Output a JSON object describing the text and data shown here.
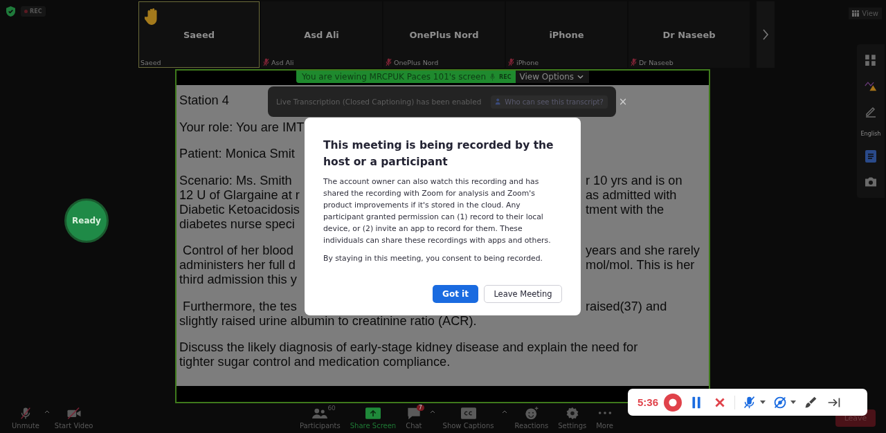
{
  "top_bar": {
    "rec_badge": "REC",
    "view_button": "View"
  },
  "participants": [
    {
      "name": "Saeed",
      "label": "Saeed",
      "muted": false,
      "hand_raised": true,
      "selected": true
    },
    {
      "name": "Asd Ali",
      "label": "Asd Ali",
      "muted": true,
      "hand_raised": false,
      "selected": false
    },
    {
      "name": "OnePlus Nord",
      "label": "OnePlus Nord",
      "muted": true,
      "hand_raised": false,
      "selected": false
    },
    {
      "name": "iPhone",
      "label": "iPhone",
      "muted": true,
      "hand_raised": false,
      "selected": false
    },
    {
      "name": "Dr Naseeb",
      "label": "Dr Naseeb",
      "muted": true,
      "hand_raised": false,
      "selected": false
    }
  ],
  "share": {
    "banner": "You are viewing MRCPUK Paces 101's screen",
    "rec": "REC",
    "view_options": "View Options",
    "paragraphs": [
      {
        "lines": [
          {
            "left": "Station 4"
          }
        ]
      },
      {
        "lines": [
          {
            "left": "Your role: You are IMT"
          }
        ]
      },
      {
        "lines": [
          {
            "left": "Patient: Monica Smit"
          }
        ]
      },
      {
        "lines": [
          {
            "left": "Scenario: Ms. Smith",
            "right": "r 10 yrs and is on"
          },
          {
            "left": "12 U of Glargaine at r",
            "right": "as admitted with"
          },
          {
            "left": "Diabetic Ketoacidosis",
            "right": "tment with the"
          },
          {
            "left": "diabetes nurse speci"
          }
        ]
      },
      {
        "lines": [
          {
            "left": " Control of her blood",
            "right": "years and she rarely"
          },
          {
            "left": "administers her full d",
            "right": "mol/mol. This is her"
          },
          {
            "left": "third admission this y"
          }
        ]
      },
      {
        "lines": [
          {
            "left": " Furthermore, the tes",
            "right": "raised(37) and"
          },
          {
            "left": "slightly raised urine albumin to creatinine ratio (ACR)."
          }
        ]
      },
      {
        "lines": [
          {
            "left": "Discuss the likely diagnosis of early-stage kidney disease and explain the need for"
          },
          {
            "left": "tighter sugar control and medication compliance."
          }
        ]
      }
    ]
  },
  "side_panel": {
    "language": "English"
  },
  "ready": "Ready",
  "transcription": {
    "text": "Live Transcription (Closed Captioning) has been enabled",
    "link": "Who can see this transcript?",
    "close": "×"
  },
  "modal": {
    "title": "This meeting is being recorded by the host or a participant",
    "body": "The account owner can also watch this recording and has shared the recording with Zoom for analysis and Zoom's product improvements if it's stored in the cloud. Any participant granted permission can (1) record to their local device, or (2) invite an app to record for them. These individuals can share these recordings with apps and others.",
    "consent": "By staying in this meeting, you consent to being recorded.",
    "primary": "Got it",
    "secondary": "Leave Meeting"
  },
  "toolbar": {
    "left": [
      {
        "kind": "mic",
        "label": "Unmute"
      },
      {
        "kind": "video",
        "label": "Start Video"
      }
    ],
    "center": [
      {
        "kind": "participants",
        "label": "Participants",
        "count": "60"
      },
      {
        "kind": "share",
        "label": "Share Screen"
      },
      {
        "kind": "chat",
        "label": "Chat",
        "count": "7"
      },
      {
        "kind": "captions",
        "label": "Show Captions"
      },
      {
        "kind": "reactions",
        "label": "Reactions"
      },
      {
        "kind": "settings",
        "label": "Settings"
      },
      {
        "kind": "more",
        "label": "More"
      }
    ],
    "leave": "Leave"
  },
  "recorder": {
    "time": "5:36"
  }
}
